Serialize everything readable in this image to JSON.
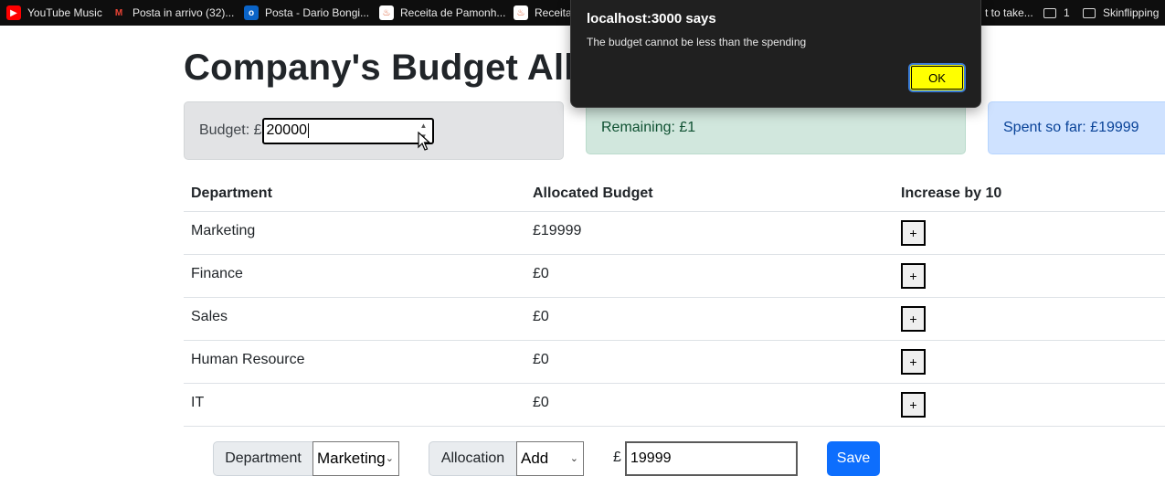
{
  "bookmarks": [
    {
      "label": "YouTube Music",
      "icon": "youtube-music-icon"
    },
    {
      "label": "Posta in arrivo (32)...",
      "icon": "gmail-icon"
    },
    {
      "label": "Posta - Dario Bongi...",
      "icon": "outlook-icon"
    },
    {
      "label": "Receita de Pamonh...",
      "icon": "recipe-icon"
    },
    {
      "label": "Receita",
      "icon": "recipe-icon"
    },
    {
      "label": "t to take...",
      "icon": ""
    },
    {
      "label": "1",
      "icon": "folder-icon"
    },
    {
      "label": "Skinflipping",
      "icon": "folder-icon"
    }
  ],
  "page": {
    "title": "Company's Budget Allo"
  },
  "budget": {
    "label": "Budget: £",
    "value": "20000"
  },
  "remaining": {
    "text": "Remaining: £1"
  },
  "spent": {
    "text": "Spent so far: £19999"
  },
  "table": {
    "headers": [
      "Department",
      "Allocated Budget",
      "Increase by 10"
    ],
    "rows": [
      {
        "department": "Marketing",
        "budget": "£19999",
        "action": "+"
      },
      {
        "department": "Finance",
        "budget": "£0",
        "action": "+"
      },
      {
        "department": "Sales",
        "budget": "£0",
        "action": "+"
      },
      {
        "department": "Human Resource",
        "budget": "£0",
        "action": "+"
      },
      {
        "department": "IT",
        "budget": "£0",
        "action": "+"
      }
    ]
  },
  "form": {
    "department_label": "Department",
    "department_value": "Marketing",
    "allocation_label": "Allocation",
    "allocation_value": "Add",
    "currency": "£",
    "amount_value": "19999",
    "save_label": "Save"
  },
  "dialog": {
    "title": "localhost:3000 says",
    "message": "The budget cannot be less than the spending",
    "ok_label": "OK"
  },
  "colors": {
    "primary": "#0d6efd",
    "remaining_bg": "#d1e7dd",
    "spent_bg": "#cfe2ff",
    "budget_bg": "#e2e3e5",
    "dialog_bg": "#202020",
    "ok_button": "#ffff00"
  }
}
